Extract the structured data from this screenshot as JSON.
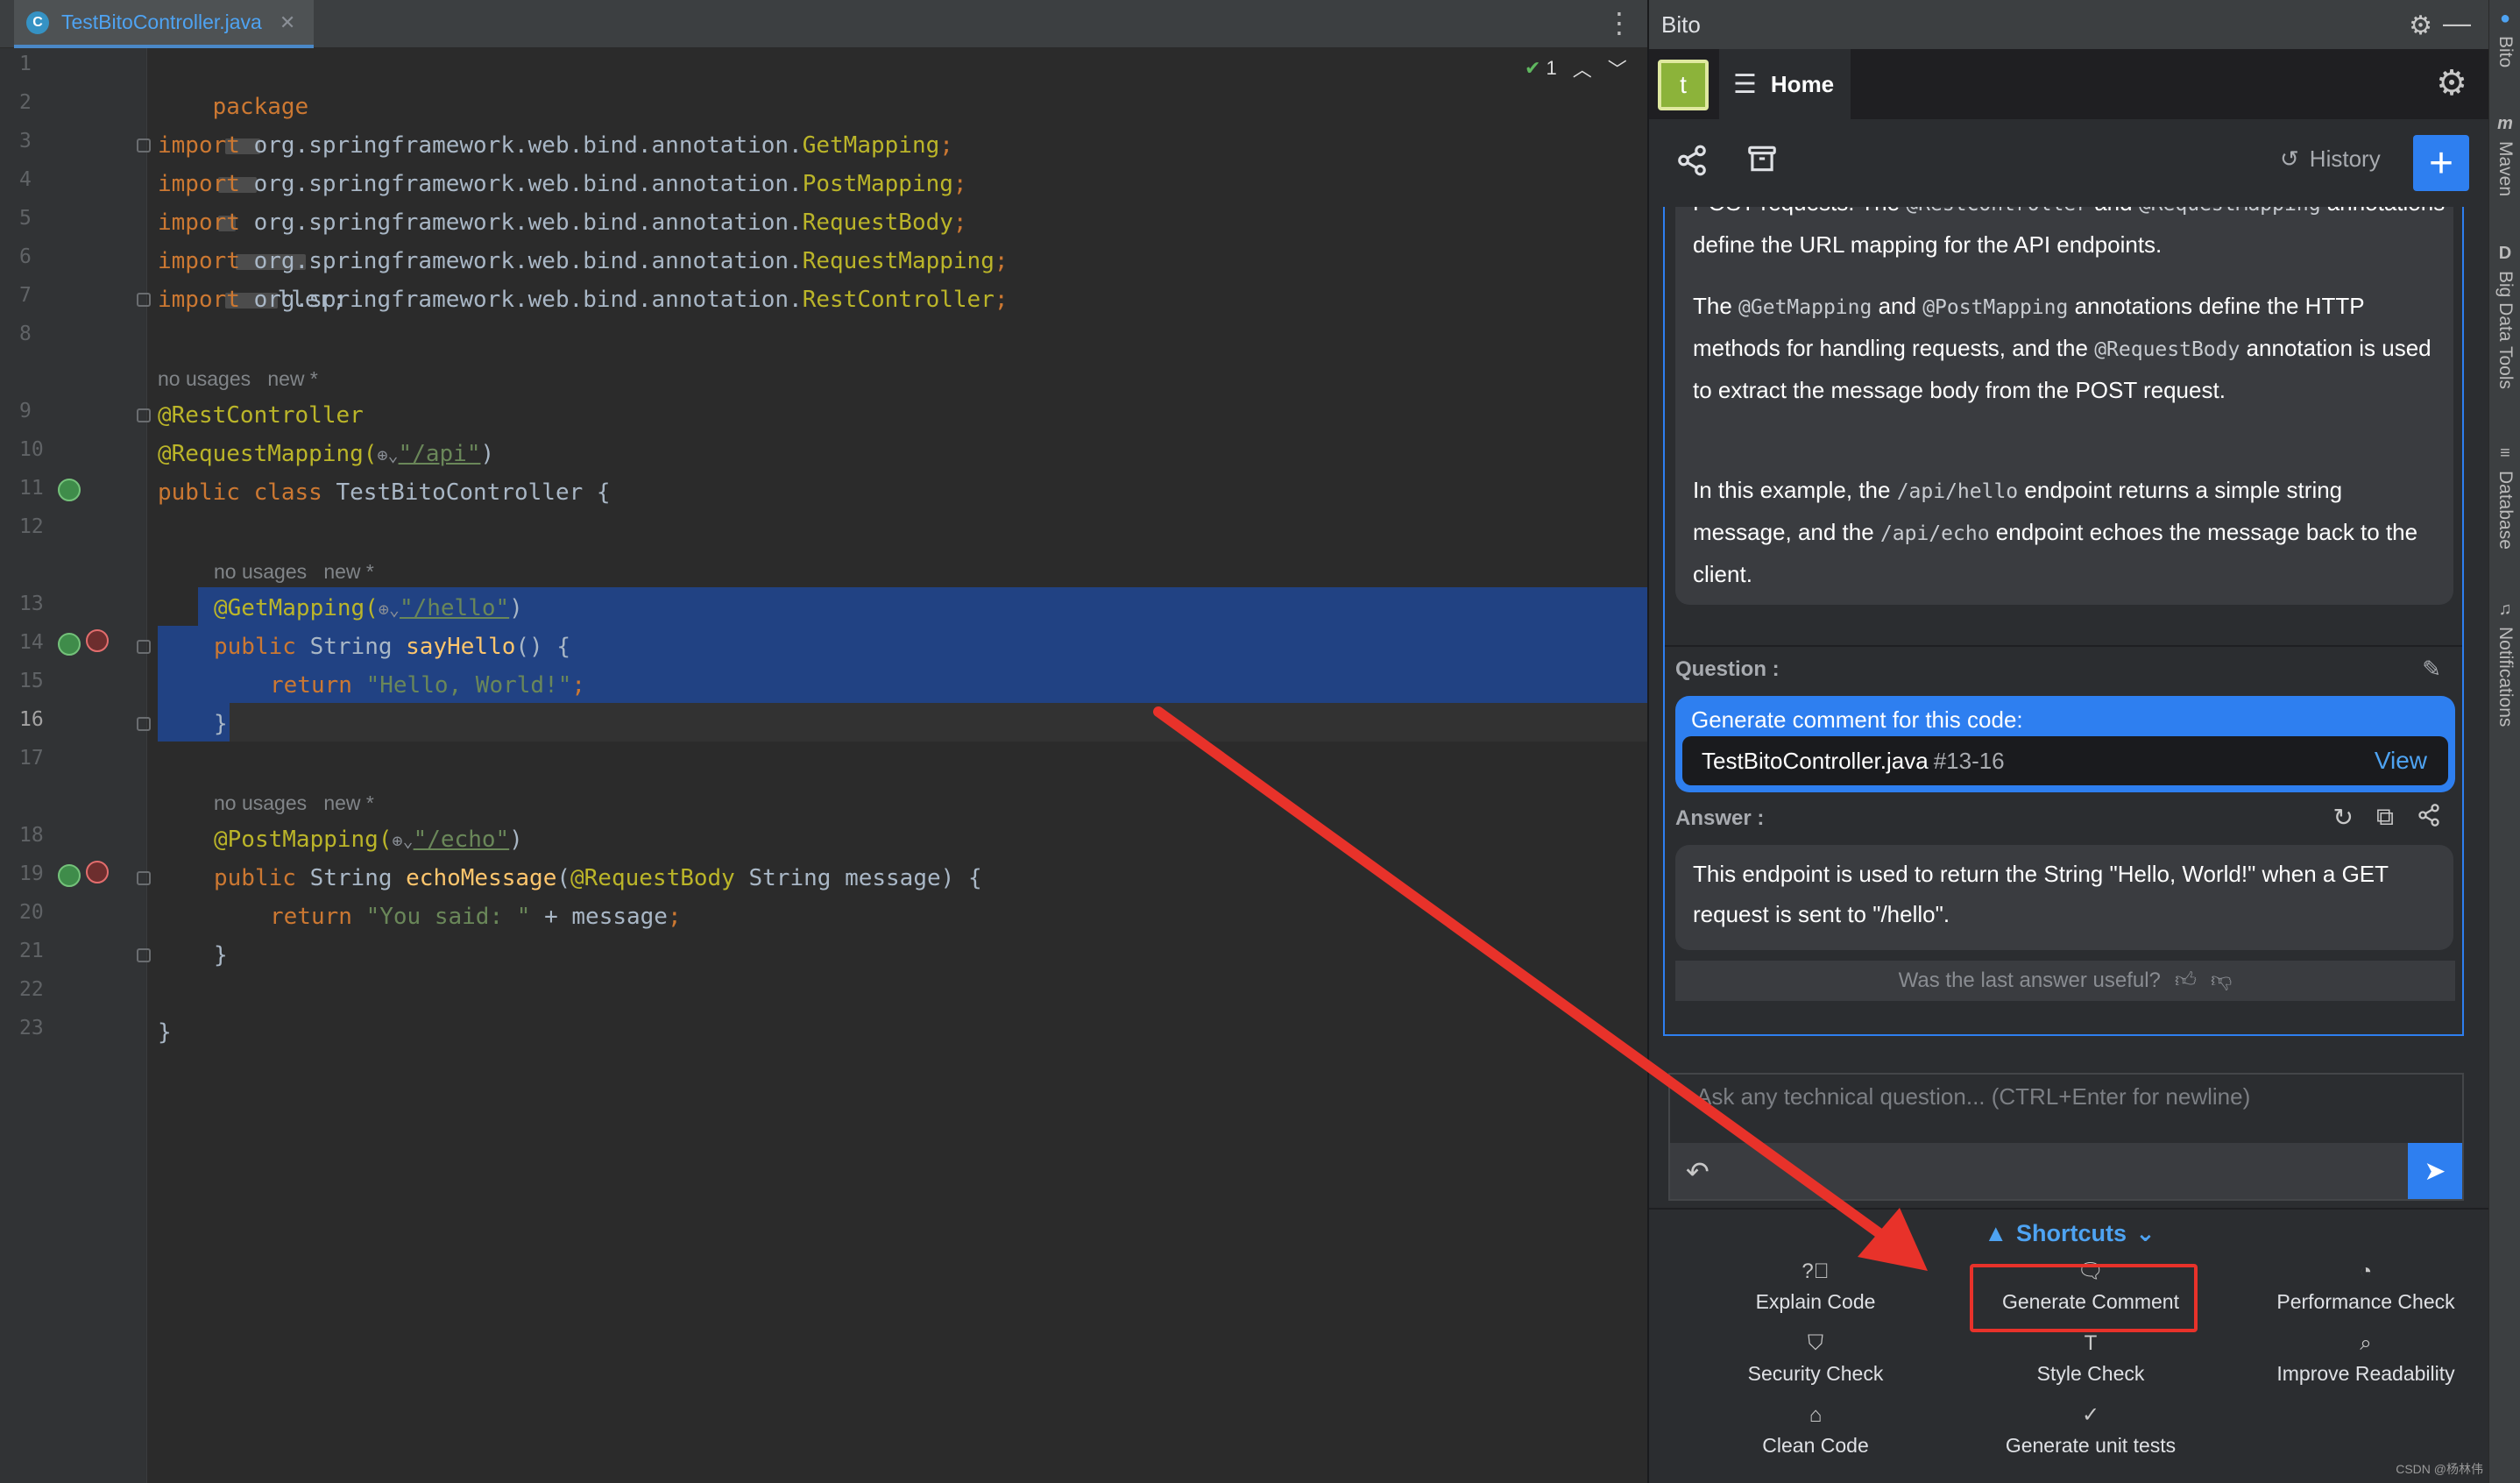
{
  "editor": {
    "tab_label": "TestBitoController.java",
    "tab_icon": "C",
    "inspection_count": "1",
    "lines": [
      {
        "n": "1"
      },
      {
        "n": "2"
      },
      {
        "n": "3"
      },
      {
        "n": "4"
      },
      {
        "n": "5"
      },
      {
        "n": "6"
      },
      {
        "n": "7"
      },
      {
        "n": "8"
      },
      {
        "n": "9"
      },
      {
        "n": "10"
      },
      {
        "n": "11"
      },
      {
        "n": "12"
      },
      {
        "n": "13"
      },
      {
        "n": "14"
      },
      {
        "n": "15"
      },
      {
        "n": "16"
      },
      {
        "n": "17"
      },
      {
        "n": "18"
      },
      {
        "n": "19"
      },
      {
        "n": "20"
      },
      {
        "n": "21"
      },
      {
        "n": "22"
      },
      {
        "n": "23"
      }
    ],
    "code": {
      "l1_kw": "package",
      "l1_tail": "ller;",
      "import_kw": "import",
      "l3_pkg": " org.springframework.web.bind.annotation.",
      "l3_cls": "GetMapping",
      "l4_cls": "PostMapping",
      "l5_cls": "RequestBody",
      "l6_cls": "RequestMapping",
      "l7_cls": "RestController",
      "semi": ";",
      "hint_no_usages": "no usages",
      "hint_new": "new *",
      "l9": "@RestController",
      "l10_ann": "@RequestMapping(",
      "l10_path": "\"/api\"",
      "l10_close": ")",
      "l11_kw": "public class",
      "l11_rest": " TestBitoController {",
      "l13_ann": "@GetMapping(",
      "l13_path": "\"/hello\"",
      "l13_close": ")",
      "l14_kw": "public",
      "l14_type": " String ",
      "l14_fn": "sayHello",
      "l14_rest": "() {",
      "return_kw": "return",
      "l15_str": " \"Hello, World!\"",
      "close_brace": "}",
      "l18_ann": "@PostMapping(",
      "l18_path": "\"/echo\"",
      "l18_close": ")",
      "l19_fn": "echoMessage",
      "l19_open": "(",
      "l19_ann": "@RequestBody",
      "l19_rest": " String message) {",
      "l20_str": " \"You said: \"",
      "l20_rest": " + message",
      "globe": "⊕⌄"
    }
  },
  "bito": {
    "title": "Bito",
    "avatar_letter": "t",
    "home_label": "Home",
    "history_label": "History",
    "message": {
      "p1_a": "POST requests. The ",
      "p1_code1": "@RestController",
      "p1_b": " and ",
      "p1_code2": "@RequestMapping",
      "p1_c": " annotations define the URL mapping for the API endpoints.",
      "p2_a": "The ",
      "p2_code1": "@GetMapping",
      "p2_b": " and ",
      "p2_code2": "@PostMapping",
      "p2_c": " annotations define the HTTP methods for handling requests, and the ",
      "p2_code3": "@RequestBody",
      "p2_d": " annotation is used to extract the message body from the POST request.",
      "p3_a": "In this example, the ",
      "p3_code1": "/api/hello",
      "p3_b": " endpoint returns a simple string message, and the ",
      "p3_code2": "/api/echo",
      "p3_c": " endpoint echoes the message back to the client."
    },
    "question_label": "Question :",
    "question_head": "Generate comment for this code:",
    "question_file": "TestBitoController.java",
    "question_range": "#13-16",
    "question_view": "View",
    "answer_label": "Answer :",
    "answer_text": "This endpoint is used to return the String \"Hello, World!\" when a GET request is sent to \"/hello\".",
    "feedback": "Was the last answer useful?",
    "input_placeholder": "Ask any technical question... (CTRL+Enter for newline)",
    "shortcuts_label": "Shortcuts",
    "shortcuts": [
      {
        "label": "Explain Code",
        "icon": "question-icon"
      },
      {
        "label": "Generate Comment",
        "icon": "comment-plus-icon"
      },
      {
        "label": "Performance Check",
        "icon": "gauge-icon"
      },
      {
        "label": "Security Check",
        "icon": "shield-icon"
      },
      {
        "label": "Style Check",
        "icon": "text-style-icon"
      },
      {
        "label": "Improve Readability",
        "icon": "search-text-icon"
      },
      {
        "label": "Clean Code",
        "icon": "broom-icon"
      },
      {
        "label": "Generate unit tests",
        "icon": "check-circle-icon"
      }
    ]
  },
  "tool_strip": {
    "bito": "Bito",
    "maven": "Maven",
    "big_data": "Big Data Tools",
    "database": "Database",
    "notifications": "Notifications"
  },
  "watermark": "CSDN @杨林伟",
  "colors": {
    "accent": "#2e7ff0",
    "selection": "#214283",
    "annotation_arrow": "#e8322a"
  }
}
